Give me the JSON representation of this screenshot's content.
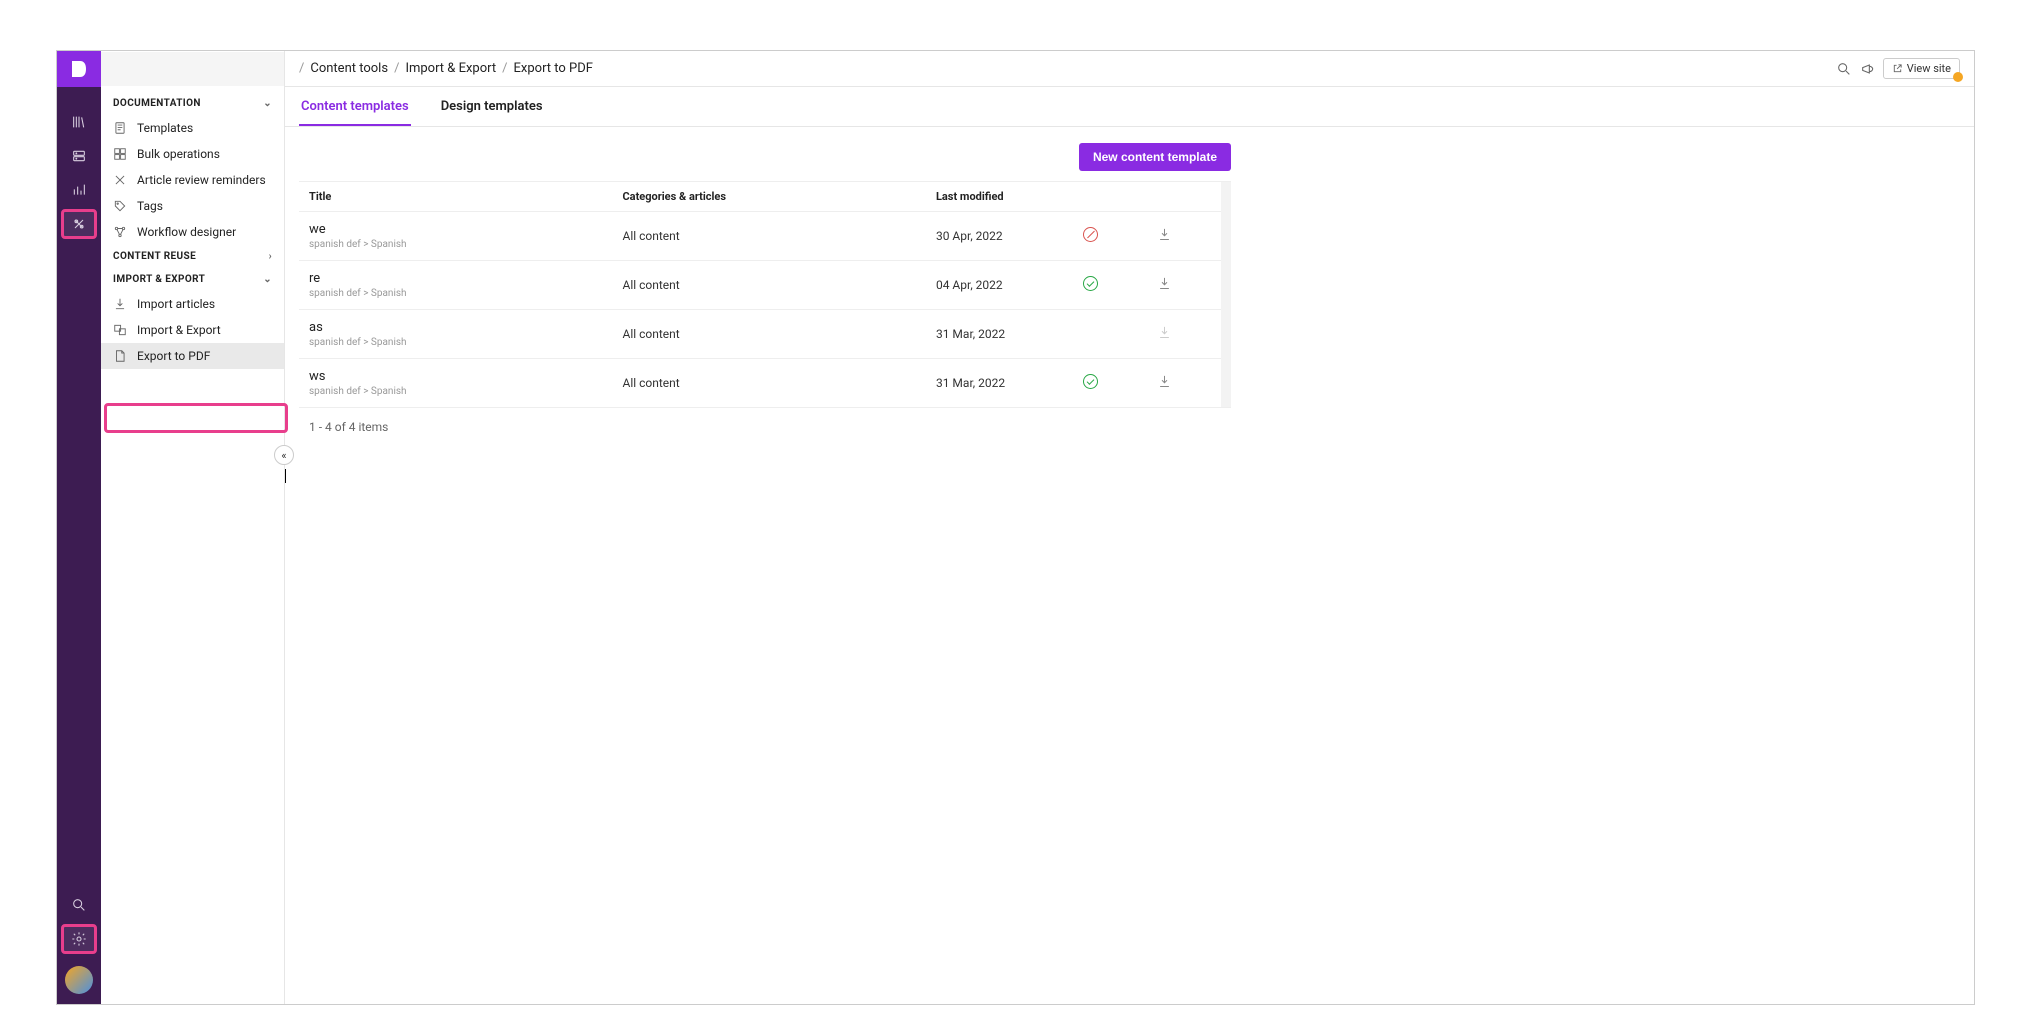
{
  "breadcrumbs": [
    "Content tools",
    "Import & Export",
    "Export to PDF"
  ],
  "view_site_label": "View site",
  "sidebar": {
    "sections": {
      "documentation": {
        "title": "DOCUMENTATION",
        "items": [
          "Templates",
          "Bulk operations",
          "Article review reminders",
          "Tags",
          "Workflow designer"
        ]
      },
      "content_reuse": {
        "title": "CONTENT REUSE"
      },
      "import_export": {
        "title": "IMPORT & EXPORT",
        "items": [
          "Import articles",
          "Import & Export",
          "Export to PDF"
        ]
      }
    }
  },
  "tabs": {
    "content": "Content templates",
    "design": "Design templates"
  },
  "buttons": {
    "new_template": "New content template"
  },
  "table": {
    "headers": {
      "title": "Title",
      "categories": "Categories & articles",
      "modified": "Last modified"
    },
    "rows": [
      {
        "title": "we",
        "sub": "spanish def > Spanish",
        "categories": "All content",
        "modified": "30 Apr, 2022",
        "status": "blocked",
        "download": true
      },
      {
        "title": "re",
        "sub": "spanish def > Spanish",
        "categories": "All content",
        "modified": "04 Apr, 2022",
        "status": "ok",
        "download": true
      },
      {
        "title": "as",
        "sub": "spanish def > Spanish",
        "categories": "All content",
        "modified": "31 Mar, 2022",
        "status": "",
        "download": false
      },
      {
        "title": "ws",
        "sub": "spanish def > Spanish",
        "categories": "All content",
        "modified": "31 Mar, 2022",
        "status": "ok",
        "download": true
      }
    ],
    "pager": "1 - 4 of 4 items"
  }
}
